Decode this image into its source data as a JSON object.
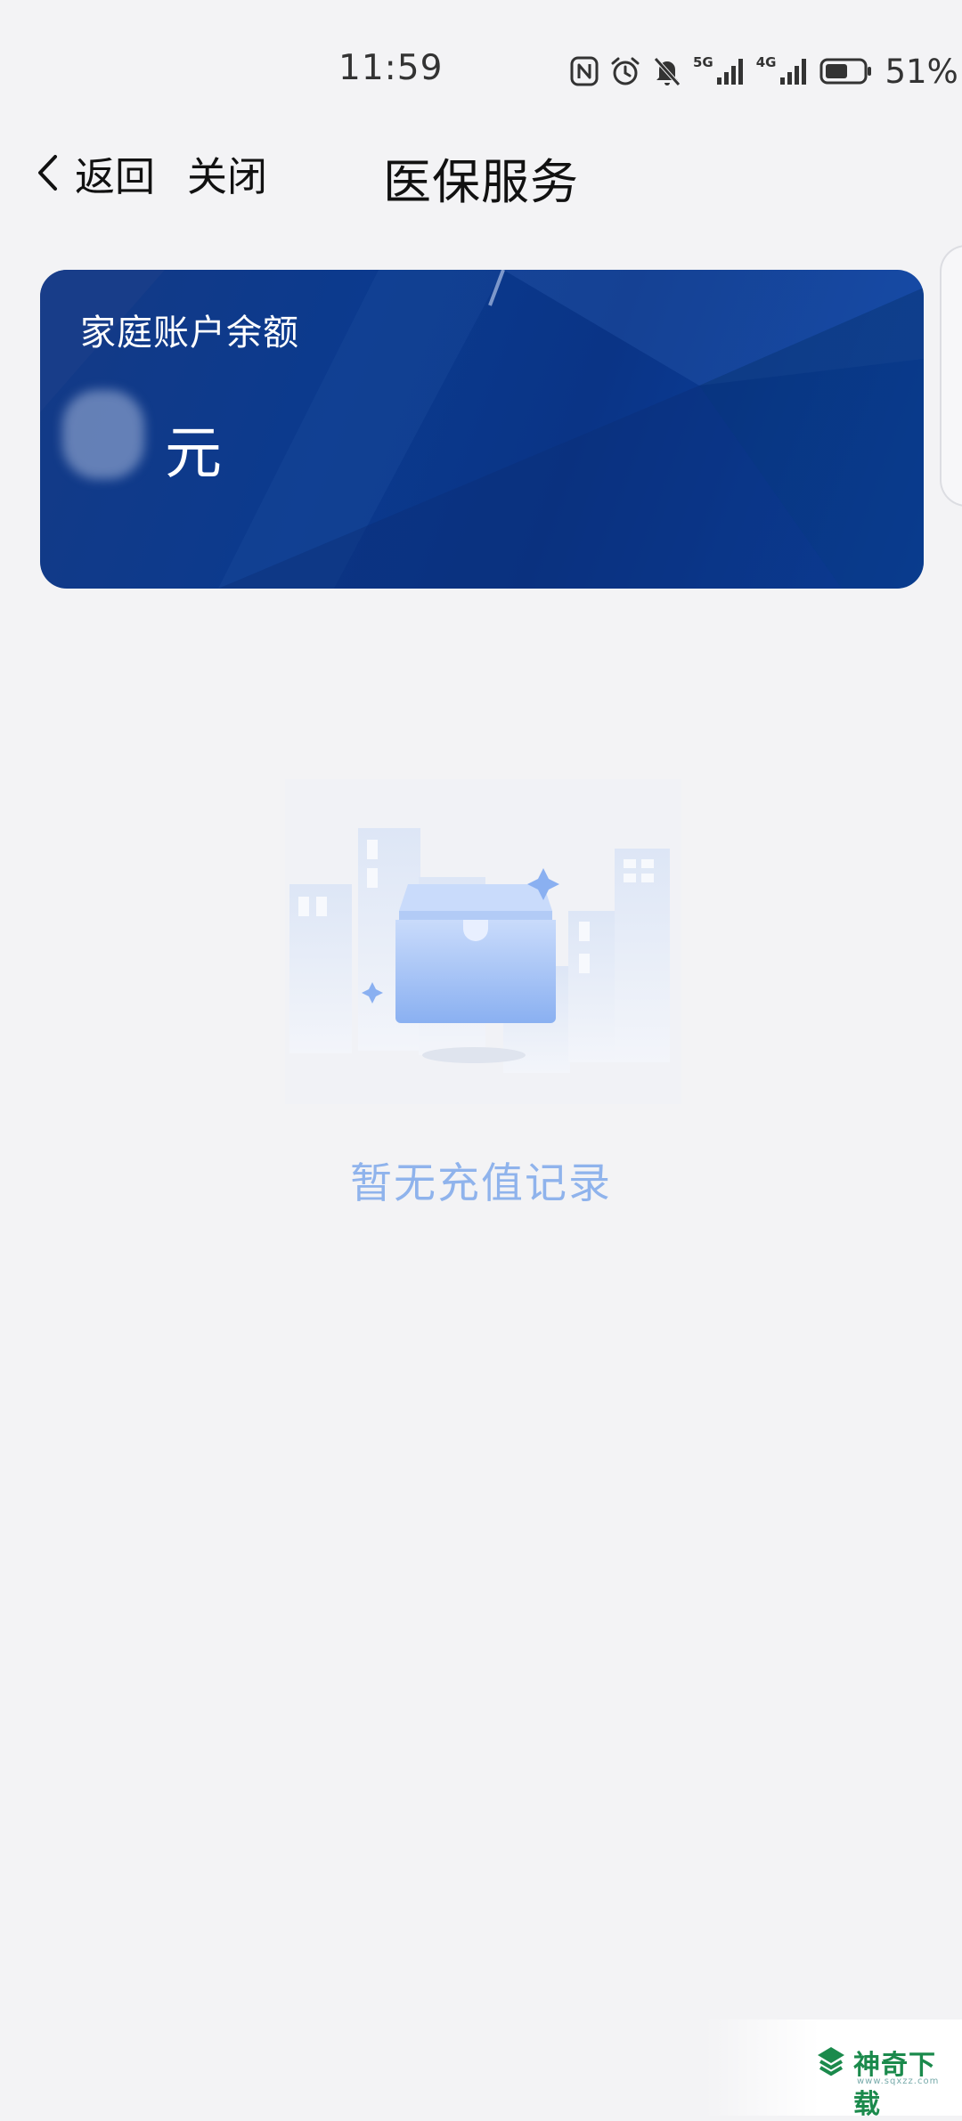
{
  "status_bar": {
    "time": "11:59",
    "signal1_label": "5G",
    "signal2_label": "4G",
    "battery_percent": "51%",
    "icons": [
      "nfc-icon",
      "alarm-icon",
      "mute-icon",
      "signal-5g-icon",
      "signal-4g-icon",
      "battery-icon"
    ]
  },
  "nav": {
    "back_label": "返回",
    "close_label": "关闭",
    "title": "医保服务"
  },
  "card": {
    "label": "家庭账户余额",
    "unit": "元",
    "colors": {
      "start": "#143a86",
      "end": "#0b45a8"
    }
  },
  "empty_state": {
    "message": "暂无充值记录",
    "color": "#8fb3ec"
  },
  "watermark": {
    "text": "神奇下载",
    "sub": "www.sqxzz.com"
  }
}
